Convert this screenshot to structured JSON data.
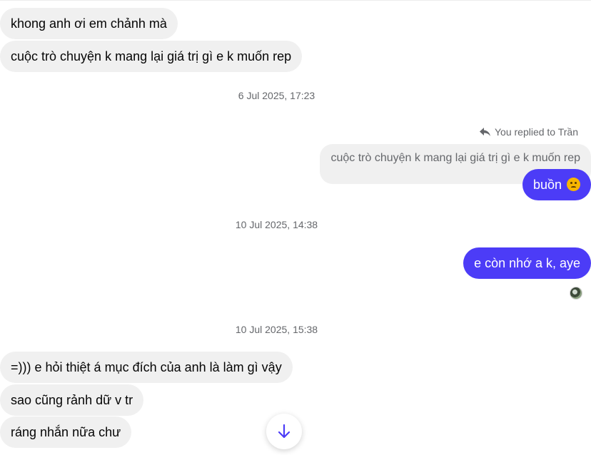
{
  "messages_top": [
    {
      "text": "khong anh ơi em chảnh mà"
    },
    {
      "text": "cuộc trò chuyện k mang lại giá trị gì e k muốn rep"
    }
  ],
  "timestamps": [
    "6 Jul 2025, 17:23",
    "10 Jul 2025, 14:38",
    "10 Jul 2025, 15:38"
  ],
  "reply": {
    "label": "You replied to Trần",
    "quoted_text": "cuộc trò chuyện k mang lại giá trị gì e k muốn rep",
    "message": "buồn",
    "emoji": "frowning-face"
  },
  "outgoing_2": {
    "text": "e còn nhớ a k, aye"
  },
  "messages_bottom": [
    {
      "text": "=))) e hỏi thiệt á mục đích của anh là làm gì vậy"
    },
    {
      "text": "sao cũng rảnh dữ v tr"
    },
    {
      "text": "ráng nhắn nữa chư"
    }
  ],
  "colors": {
    "outgoing_bubble": "#4c3cf7",
    "incoming_bubble": "#f0f0f0",
    "timestamp_text": "#65676b"
  },
  "icons": {
    "reply": "reply-arrow-icon",
    "scroll": "arrow-down-icon",
    "seen": "seen-avatar"
  }
}
